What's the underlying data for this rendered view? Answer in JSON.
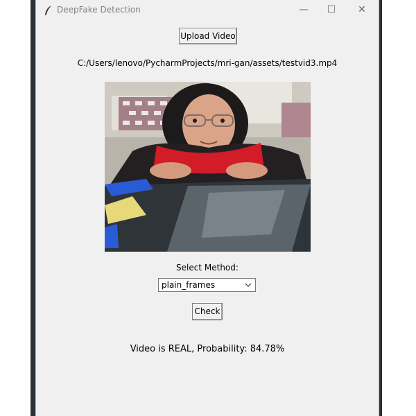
{
  "window": {
    "title": "DeepFake Detection",
    "controls": {
      "minimize": "—",
      "maximize": "☐",
      "close": "✕"
    }
  },
  "upload_button": {
    "label": "Upload Video"
  },
  "file_path": "C:/Users/lenovo/PycharmProjects/mri-gan/assets/testvid3.mp4",
  "preview": {
    "icon": "video-frame-image"
  },
  "method": {
    "label": "Select Method:",
    "selected": "plain_frames"
  },
  "check_button": {
    "label": "Check"
  },
  "result_text": "Video is REAL, Probability: 84.78%",
  "colors": {
    "window_bg": "#f0f0f0",
    "desktop": "#2b2f36"
  }
}
